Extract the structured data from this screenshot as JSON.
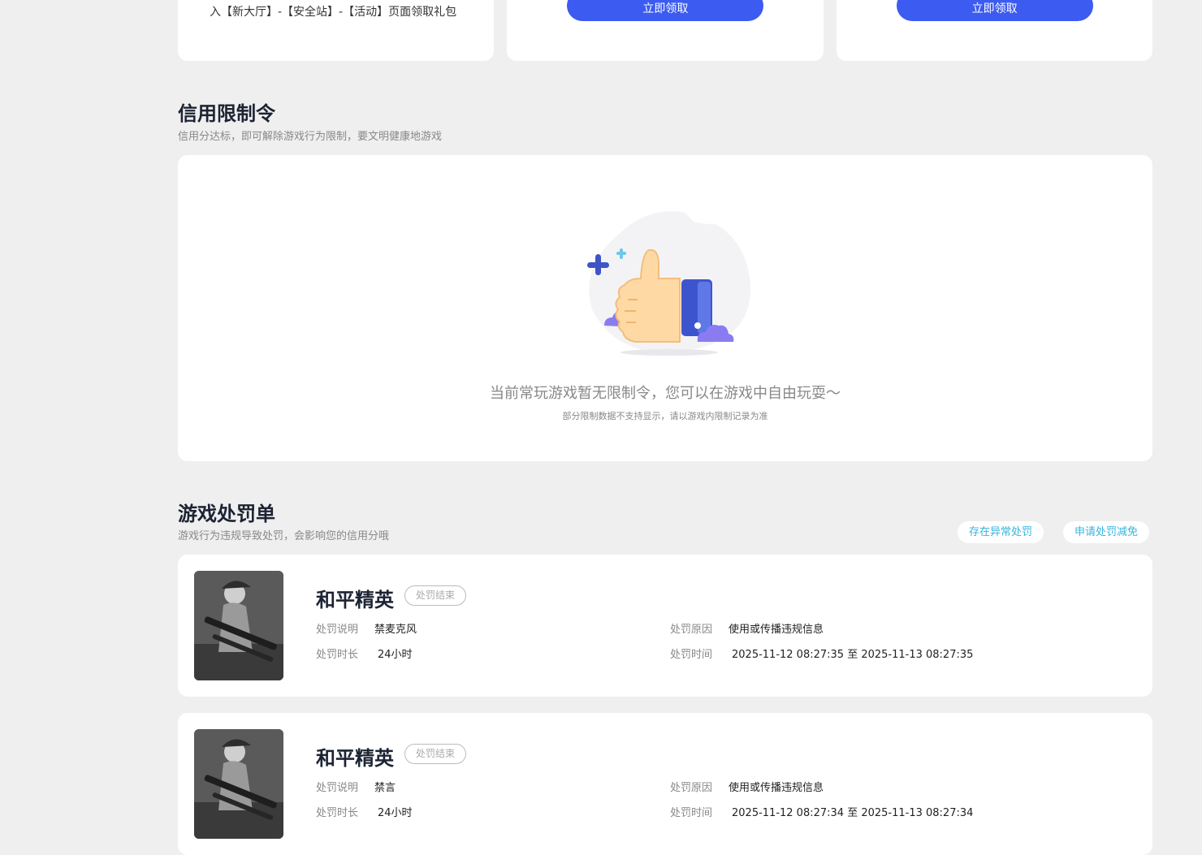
{
  "rewards": {
    "desc": "领取方式：每个自然月领取一次。前往游戏内，进入【新大厅】-【安全站】-【活动】页面领取礼包",
    "claim_label": "立即领取"
  },
  "credit_section": {
    "title": "信用限制令",
    "subtitle": "信用分达标，即可解除游戏行为限制，要文明健康地游戏",
    "empty_message": "当前常玩游戏暂无限制令，您可以在游戏中自由玩耍～",
    "empty_note": "部分限制数据不支持显示，请以游戏内限制记录为准"
  },
  "penalty_section": {
    "title": "游戏处罚单",
    "subtitle": "游戏行为违规导致处罚，会影响您的信用分哦",
    "abnormal_label": "存在异常处罚",
    "appeal_label": "申请处罚减免",
    "field_labels": {
      "desc": "处罚说明",
      "reason": "处罚原因",
      "duration": "处罚时长",
      "time": "处罚时间"
    },
    "items": [
      {
        "game": "和平精英",
        "status": "处罚结束",
        "desc": "禁麦克风",
        "reason": "使用或传播违规信息",
        "duration": "24小时",
        "time": "2025-11-12 08:27:35 至 2025-11-13 08:27:35"
      },
      {
        "game": "和平精英",
        "status": "处罚结束",
        "desc": "禁言",
        "reason": "使用或传播违规信息",
        "duration": "24小时",
        "time": "2025-11-12 08:27:34 至 2025-11-13 08:27:34"
      }
    ]
  },
  "colors": {
    "accent": "#3c5bf0",
    "link": "#35b5e0",
    "background": "#efefef"
  }
}
